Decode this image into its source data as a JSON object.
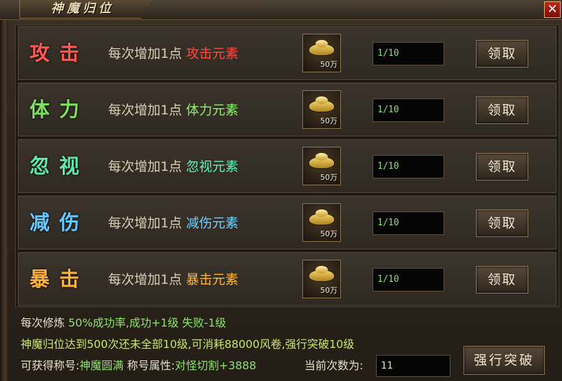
{
  "window": {
    "title": "神魔归位",
    "close_label": "✕"
  },
  "rows": [
    {
      "name": "攻击",
      "desc": "每次增加1点",
      "element": "攻击元素",
      "reward": "50万",
      "progress": "1/10",
      "button": "领取",
      "color": "#ff5a52"
    },
    {
      "name": "体力",
      "desc": "每次增加1点",
      "element": "体力元素",
      "reward": "50万",
      "progress": "1/10",
      "button": "领取",
      "color": "#7fe060"
    },
    {
      "name": "忽视",
      "desc": "每次增加1点",
      "element": "忽视元素",
      "reward": "50万",
      "progress": "1/10",
      "button": "领取",
      "color": "#5fe7a3"
    },
    {
      "name": "减伤",
      "desc": "每次增加1点",
      "element": "减伤元素",
      "reward": "50万",
      "progress": "1/10",
      "button": "领取",
      "color": "#63c8ff"
    },
    {
      "name": "暴击",
      "desc": "每次增加1点",
      "element": "暴击元素",
      "reward": "50万",
      "progress": "1/10",
      "button": "领取",
      "color": "#ffb13a"
    }
  ],
  "footer": {
    "line1_a": "每次修炼",
    "line1_b": "50%成功率,成功+1级 失败-1级",
    "line2": "神魔归位达到500次还未全部10级,可消耗88000风卷,强行突破10级",
    "line3_a": "可获得称号:",
    "line3_b": "神魔圆满",
    "line3_c": " 称号属性:",
    "line3_d": "对怪切割+3888",
    "count_label": "当前次数为:",
    "count_value": "11",
    "force_button": "强行突破"
  }
}
